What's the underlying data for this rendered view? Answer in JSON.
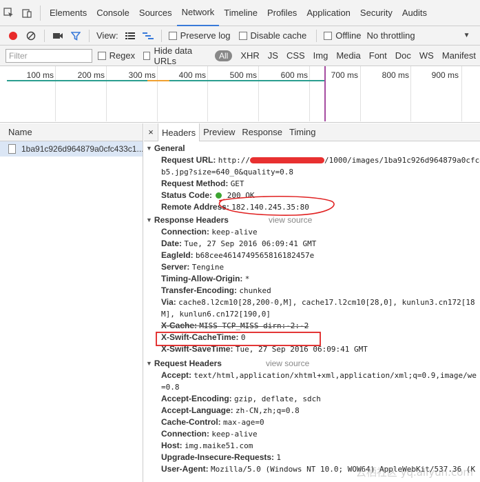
{
  "main_tabs": {
    "items": [
      {
        "label": "Elements"
      },
      {
        "label": "Console"
      },
      {
        "label": "Sources"
      },
      {
        "label": "Network",
        "active": true
      },
      {
        "label": "Timeline"
      },
      {
        "label": "Profiles"
      },
      {
        "label": "Application"
      },
      {
        "label": "Security"
      },
      {
        "label": "Audits"
      }
    ]
  },
  "toolbar": {
    "view_label": "View:",
    "preserve_log": "Preserve log",
    "disable_cache": "Disable cache",
    "offline": "Offline",
    "throttling": "No throttling",
    "record_color": "#e82a2a",
    "filter_color": "#3879d9"
  },
  "filter_bar": {
    "placeholder": "Filter",
    "regex": "Regex",
    "hide_data_urls": "Hide data URLs",
    "all": "All",
    "types": [
      "XHR",
      "JS",
      "CSS",
      "Img",
      "Media",
      "Font",
      "Doc",
      "WS",
      "Manifest"
    ]
  },
  "timeline": {
    "ticks": [
      "100 ms",
      "200 ms",
      "300 ms",
      "400 ms",
      "500 ms",
      "600 ms",
      "700 ms",
      "800 ms",
      "900 ms"
    ]
  },
  "requests": {
    "header": "Name",
    "items": [
      {
        "name": "1ba91c926d964879a0cfc433c1..."
      }
    ]
  },
  "detail_tabs": {
    "close": "×",
    "items": [
      {
        "label": "Headers",
        "active": true
      },
      {
        "label": "Preview"
      },
      {
        "label": "Response"
      },
      {
        "label": "Timing"
      }
    ]
  },
  "general": {
    "title": "General",
    "request_url_key": "Request URL:",
    "request_url_prefix": "http://",
    "request_url_suffix": "/1000/images/1ba91c926d964879a0cfc4",
    "request_url_cont": "b5.jpg?size=640_0&quality=0.8",
    "request_method_key": "Request Method:",
    "request_method_val": "GET",
    "status_code_key": "Status Code:",
    "status_code_val": "200 OK",
    "remote_address_key": "Remote Address:",
    "remote_address_val": "182.140.245.35:80"
  },
  "response_headers": {
    "title": "Response Headers",
    "view_source": "view source",
    "rows": [
      {
        "k": "Connection:",
        "v": "keep-alive"
      },
      {
        "k": "Date:",
        "v": "Tue, 27 Sep 2016 06:09:41 GMT"
      },
      {
        "k": "EagleId:",
        "v": "b68cee4614749565816182457e"
      },
      {
        "k": "Server:",
        "v": "Tengine"
      },
      {
        "k": "Timing-Allow-Origin:",
        "v": "*"
      },
      {
        "k": "Transfer-Encoding:",
        "v": "chunked"
      },
      {
        "k": "Via:",
        "v": "cache8.l2cm10[28,200-0,M], cache17.l2cm10[28,0], kunlun3.cn172[18"
      }
    ],
    "via_cont": "M], kunlun6.cn172[190,0]",
    "xcache_k": "X-Cache:",
    "xcache_v": "MISS TCP_MISS dirn:-2:-2",
    "swift_cache_k": "X-Swift-CacheTime:",
    "swift_cache_v": "0",
    "swift_save_k": "X-Swift-SaveTime:",
    "swift_save_v": "Tue, 27 Sep 2016 06:09:41 GMT"
  },
  "request_headers": {
    "title": "Request Headers",
    "view_source": "view source",
    "accept_k": "Accept:",
    "accept_v": "text/html,application/xhtml+xml,application/xml;q=0.9,image/we",
    "accept_cont": "=0.8",
    "rows": [
      {
        "k": "Accept-Encoding:",
        "v": "gzip, deflate, sdch"
      },
      {
        "k": "Accept-Language:",
        "v": "zh-CN,zh;q=0.8"
      },
      {
        "k": "Cache-Control:",
        "v": "max-age=0"
      },
      {
        "k": "Connection:",
        "v": "keep-alive"
      },
      {
        "k": "Host:",
        "v": "img.maike51.com"
      },
      {
        "k": "Upgrade-Insecure-Requests:",
        "v": "1"
      },
      {
        "k": "User-Agent:",
        "v": "Mozilla/5.0 (Windows NT 10.0; WOW64) AppleWebKit/537.36 (K"
      }
    ]
  },
  "watermark": "云栖社区 yq.aliyun.com"
}
